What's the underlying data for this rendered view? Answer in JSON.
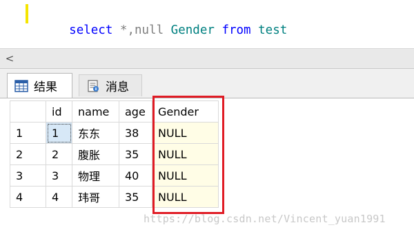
{
  "editor": {
    "tokens": [
      {
        "text": "select",
        "cls": "kw"
      },
      {
        "text": " *,",
        "cls": "plain"
      },
      {
        "text": "null",
        "cls": "gray-kw"
      },
      {
        "text": " Gender ",
        "cls": "ident"
      },
      {
        "text": "from",
        "cls": "kw"
      },
      {
        "text": " test",
        "cls": "ident"
      }
    ],
    "accent_color": "#f5e500"
  },
  "scrollbar": {
    "left_arrow": "<"
  },
  "tabs": [
    {
      "label": "结果",
      "icon": "grid-results-icon",
      "active": true
    },
    {
      "label": "消息",
      "icon": "messages-icon",
      "active": false
    }
  ],
  "grid": {
    "columns": [
      "id",
      "name",
      "age",
      "Gender"
    ],
    "rows": [
      {
        "num": "1",
        "id": "1",
        "name": "东东",
        "age": "38",
        "gender": "NULL"
      },
      {
        "num": "2",
        "id": "2",
        "name": "腹胀",
        "age": "35",
        "gender": "NULL"
      },
      {
        "num": "3",
        "id": "3",
        "name": "物理",
        "age": "40",
        "gender": "NULL"
      },
      {
        "num": "4",
        "id": "4",
        "name": "玮哥",
        "age": "35",
        "gender": "NULL"
      }
    ],
    "highlight_color": "#e01b24",
    "null_cell_color": "#fffde6"
  },
  "watermark": "https://blog.csdn.net/Vincent_yuan1991"
}
